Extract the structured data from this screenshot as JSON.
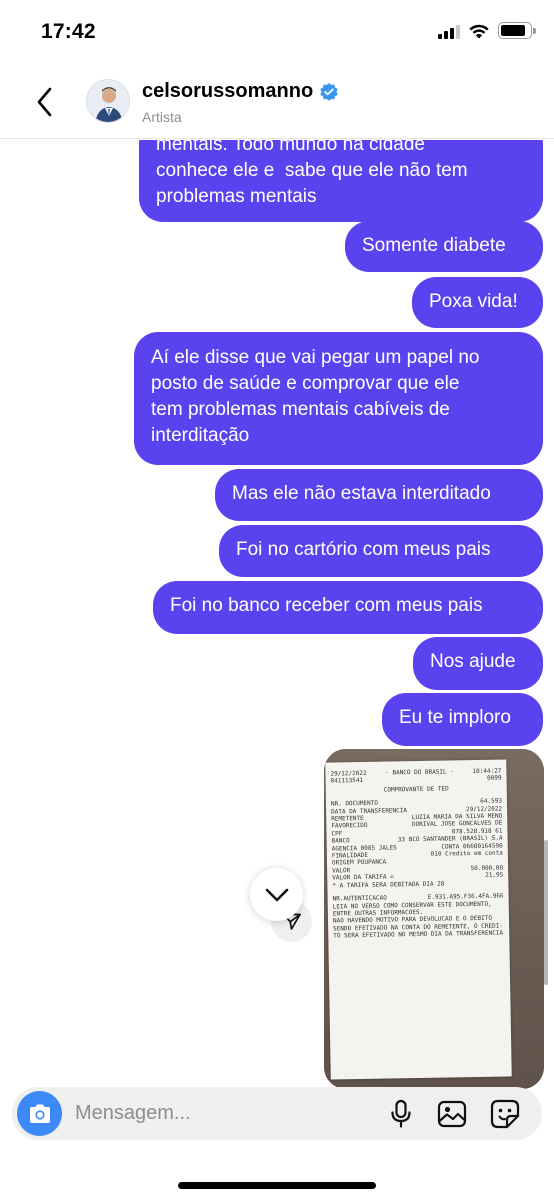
{
  "status_bar": {
    "time": "17:42",
    "battery_level": 0.85
  },
  "header": {
    "username": "celsorussomanno",
    "subtitle": "Artista",
    "verified": true,
    "icons": [
      "chevron-left-icon",
      "verified-badge-icon"
    ]
  },
  "messages": [
    {
      "text": "mentais. Todo mundo na cidade\nconhece ele e  sabe que ele não tem\nproblemas mentais",
      "sender": "me"
    },
    {
      "text": "Somente diabete",
      "sender": "me"
    },
    {
      "text": "Poxa vida!",
      "sender": "me"
    },
    {
      "text": "Aí ele disse que vai pegar um papel no\nposto de saúde e comprovar que ele\ntem problemas mentais cabíveis de\ninterditação",
      "sender": "me"
    },
    {
      "text": "Mas ele não estava interditado",
      "sender": "me"
    },
    {
      "text": "Foi no cartório com meus pais",
      "sender": "me"
    },
    {
      "text": "Foi no banco receber com meus pais",
      "sender": "me"
    },
    {
      "text": "Nos ajude",
      "sender": "me"
    },
    {
      "text": "Eu te imploro",
      "sender": "me"
    }
  ],
  "receipt": {
    "date": "29/12/2022",
    "bank": "- BANCO DO BRASIL -",
    "time": "10:44:27",
    "code_left": "041113541",
    "code_right": "0099",
    "title": "COMPROVANTE DE TED",
    "lines": [
      [
        "NR. DOCUMENTO",
        "64.593"
      ],
      [
        "DATA DA TRANSFERENCIA",
        "29/12/2022"
      ],
      [
        "REMETENTE",
        "LUZIA MARIA DA SILVA MENO"
      ],
      [
        "FAVORECIDO",
        "DORIVAL JOSE GONCALVES DE"
      ],
      [
        "CPF",
        "078.528.918 61"
      ],
      [
        "BANCO",
        "33  BCO SANTANDER (BRASIL) S.A"
      ],
      [
        "AGENCIA 0085 JALES",
        "CONTA  06600164590"
      ],
      [
        "FINALIDADE",
        "010  Credito em conta"
      ],
      [
        "ORIGEM  POUPANCA",
        ""
      ],
      [
        "VALOR",
        "50.000,00"
      ],
      [
        "VALOR DA TARIFA =",
        "21,95"
      ],
      [
        "* A TARIFA SERA DEBITADA DIA 28",
        ""
      ]
    ],
    "auth_label": "NR.AUTENTICACAO",
    "auth_value": "E.931.A95.F36.4FA.966",
    "footer": [
      "LEIA NO VERSO COMO CONSERVAR ESTE DOCUMENTO,",
      "ENTRE OUTRAS INFORMACOES.",
      "NAO HAVENDO MOTIVO PARA DEVOLUCAO E O DEBITO",
      "SENDO EFETIVADO NA CONTA DO REMETENTE, O CREDI-",
      "TO SERA EFETIVADO NO MESMO DIA DA TRANSFERENCIA"
    ]
  },
  "composer": {
    "placeholder": "Mensagem...",
    "icons": [
      "camera-icon",
      "microphone-icon",
      "gallery-icon",
      "sticker-icon"
    ]
  },
  "colors": {
    "bubble": "#5a42ef",
    "camera": "#3d8af7",
    "verified": "#3897f0"
  }
}
